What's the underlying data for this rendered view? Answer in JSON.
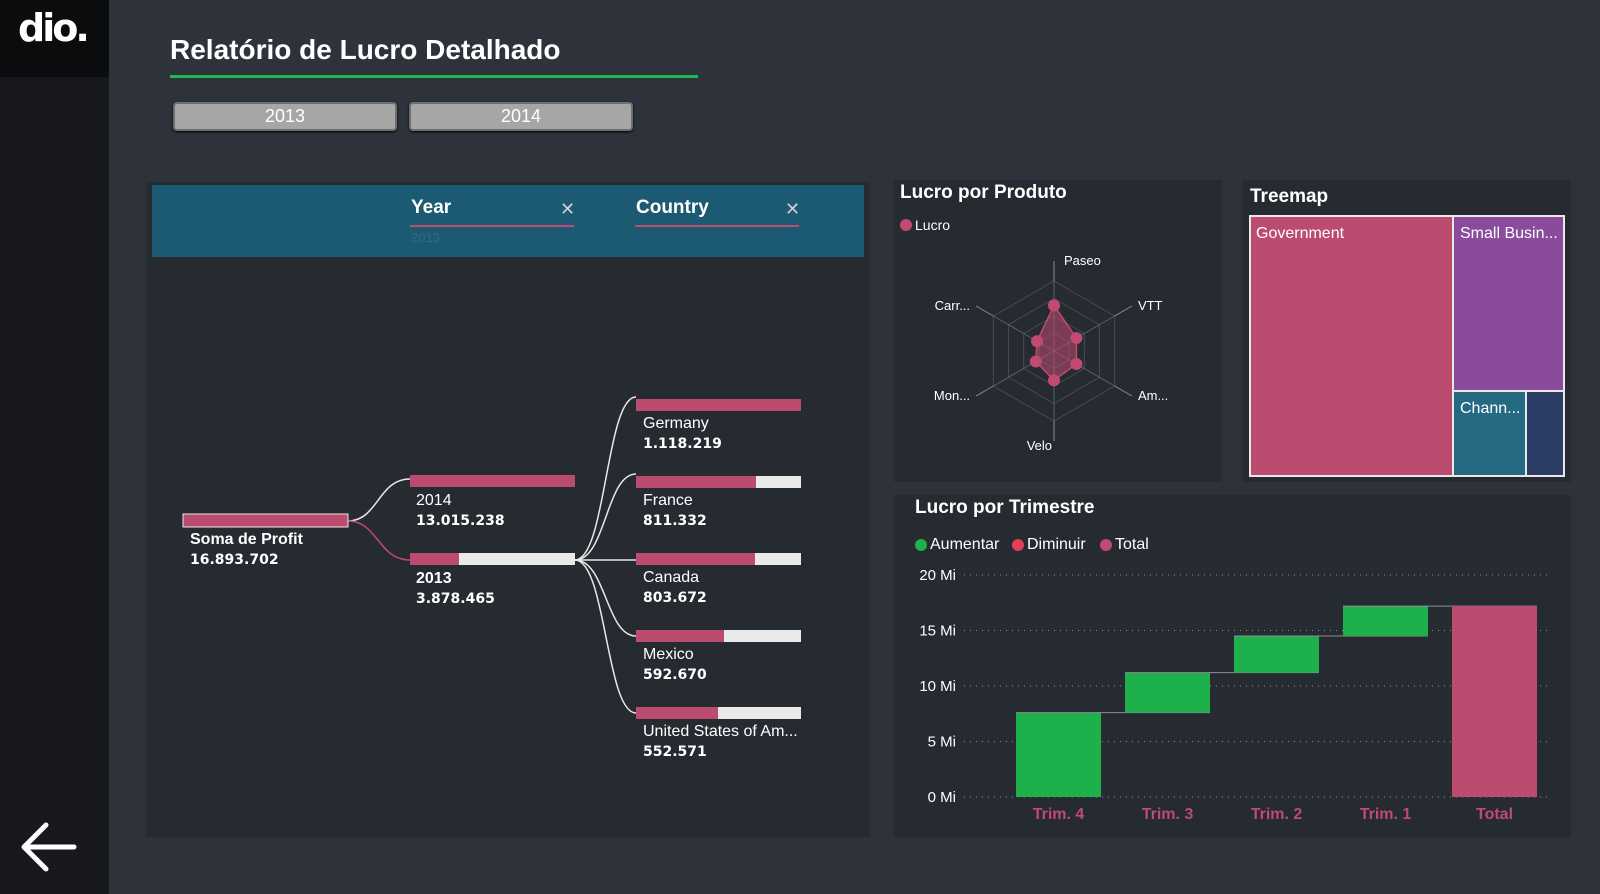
{
  "brand": {
    "logo": "dio."
  },
  "nav": {
    "back_icon": "arrow-left-icon"
  },
  "page": {
    "title": "Relatório de Lucro Detalhado"
  },
  "filters": {
    "year_buttons": [
      "2013",
      "2014"
    ]
  },
  "colors": {
    "accent": "#1db954",
    "pink": "#bb4b6f",
    "green": "#1eb04a",
    "purple": "#8a4b9c",
    "teal": "#236a82",
    "navy": "#2c3e66",
    "header": "#1c5a73"
  },
  "decomposition": {
    "headers": [
      {
        "label": "Year",
        "selected": "2013"
      },
      {
        "label": "Country",
        "selected": ""
      }
    ],
    "root": {
      "label": "Soma de Profit",
      "value": "16.893.702"
    },
    "years": [
      {
        "label": "2014",
        "value": "13.015.238"
      },
      {
        "label": "2013",
        "value": "3.878.465"
      }
    ],
    "countries": [
      {
        "label": "Germany",
        "value": "1.118.219"
      },
      {
        "label": "France",
        "value": "811.332"
      },
      {
        "label": "Canada",
        "value": "803.672"
      },
      {
        "label": "Mexico",
        "value": "592.670"
      },
      {
        "label": "United States of Am...",
        "value": "552.571"
      }
    ]
  },
  "radar": {
    "title": "Lucro por Produto",
    "legend": "Lucro",
    "axes": [
      "Paseo",
      "VTT",
      "Am...",
      "Velo",
      "Mon...",
      "Carr..."
    ]
  },
  "treemap": {
    "title": "Treemap",
    "items": [
      {
        "label": "Government"
      },
      {
        "label": "Small Busin..."
      },
      {
        "label": "Chann..."
      },
      {
        "label": ""
      }
    ]
  },
  "chart_data": [
    {
      "type": "bar",
      "title": "Lucro por Produto",
      "chart_subtype": "radar",
      "categories": [
        "Paseo",
        "VTT",
        "Am...",
        "Velo",
        "Mon...",
        "Carr..."
      ],
      "series": [
        {
          "name": "Lucro",
          "values": [
            0.65,
            0.37,
            0.37,
            0.42,
            0.3,
            0.28
          ]
        }
      ],
      "ylim": [
        0,
        1
      ],
      "grid": true,
      "legend": "top-left"
    },
    {
      "type": "bar",
      "title": "Lucro por Trimestre",
      "chart_subtype": "waterfall",
      "categories": [
        "Trim. 4",
        "Trim. 3",
        "Trim. 2",
        "Trim. 1",
        "Total"
      ],
      "series": [
        {
          "name": "Lucro",
          "values": [
            7.6,
            3.6,
            3.3,
            2.7,
            17.2
          ]
        }
      ],
      "legend_entries": [
        "Aumentar",
        "Diminuir",
        "Total"
      ],
      "y_ticks": [
        "0 Mi",
        "5 Mi",
        "10 Mi",
        "15 Mi",
        "20 Mi"
      ],
      "ylim": [
        0,
        20
      ],
      "grid": true,
      "legend": "top-left"
    }
  ]
}
